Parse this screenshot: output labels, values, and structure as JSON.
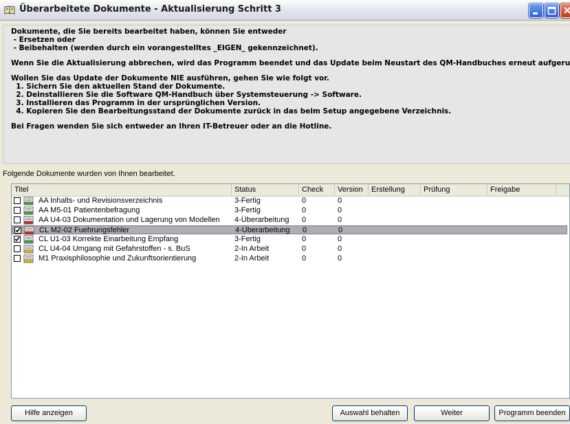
{
  "window": {
    "title": "Überarbeitete Dokumente - Aktualisierung Schritt 3",
    "icon": "book-icon",
    "controls": [
      "minimize-icon",
      "maximize-icon",
      "close-icon"
    ]
  },
  "info": {
    "lines": [
      "Dokumente, die Sie bereits bearbeitet haben, können Sie entweder",
      " - Ersetzen oder",
      " - Beibehalten (werden durch ein vorangestelltes _EIGEN_ gekennzeichnet).",
      "",
      "Wenn Sie die Aktualisierung abbrechen, wird das Programm beendet und das Update beim Neustart des QM-Handbuches erneut aufgerufen.",
      "",
      "Wollen Sie das Update der Dokumente NIE ausführen, gehen Sie wie folgt vor.",
      "  1. Sichern Sie den aktuellen Stand der Dokumente.",
      "  2. Deinstallieren Sie die Software QM-Handbuch über Systemsteuerung -> Software.",
      "  3. Installieren das Programm in der ursprünglichen Version.",
      "  4. Kopieren Sie den Bearbeitungsstand der Dokumente zurück in das beim Setup angegebene Verzeichnis.",
      "",
      "Bei Fragen wenden Sie sich entweder an Ihren IT-Betreuer oder an die Hotline."
    ]
  },
  "list": {
    "caption": "Folgende Dokumente wurden von Ihnen bearbeitet.",
    "columns": [
      "Titel",
      "Status",
      "Check",
      "Version",
      "Erstellung",
      "Prüfung",
      "Freigabe"
    ],
    "rows": [
      {
        "checked": false,
        "icon_color": "#3aa33a",
        "title": "AA Inhalts- und Revisionsverzeichnis",
        "status": "3-Fertig",
        "check": "0",
        "version": "0",
        "selected": false
      },
      {
        "checked": false,
        "icon_color": "#3aa33a",
        "title": "AA M5-01 Patientenbefragung",
        "status": "3-Fertig",
        "check": "0",
        "version": "0",
        "selected": false
      },
      {
        "checked": false,
        "icon_color": "#d02020",
        "title": "AA U4-03 Dokumentation und Lagerung von Modellen",
        "status": "4-Überarbeitung",
        "check": "0",
        "version": "0",
        "selected": false
      },
      {
        "checked": true,
        "icon_color": "#d02020",
        "title": "CL M2-02 Fuehrungsfehler",
        "status": "4-Überarbeitung",
        "check": "0",
        "version": "0",
        "selected": true
      },
      {
        "checked": true,
        "icon_color": "#3aa33a",
        "title": "CL U1-03 Korrekte Einarbeitung Empfang",
        "status": "3-Fertig",
        "check": "0",
        "version": "0",
        "selected": false
      },
      {
        "checked": false,
        "icon_color": "#e0c020",
        "title": "CL U4-04 Umgang mit Gefahrstoffen - s. BuS",
        "status": "2-In Arbeit",
        "check": "0",
        "version": "0",
        "selected": false
      },
      {
        "checked": false,
        "icon_color": "#e0c020",
        "title": "M1 Praxisphilosophie und Zukunftsorientierung",
        "status": "2-In Arbeit",
        "check": "0",
        "version": "0",
        "selected": false
      }
    ]
  },
  "buttons": {
    "help": "Hilfe anzeigen",
    "keep": "Auswahl behalten",
    "next": "Weiter",
    "quit": "Programm beenden"
  }
}
